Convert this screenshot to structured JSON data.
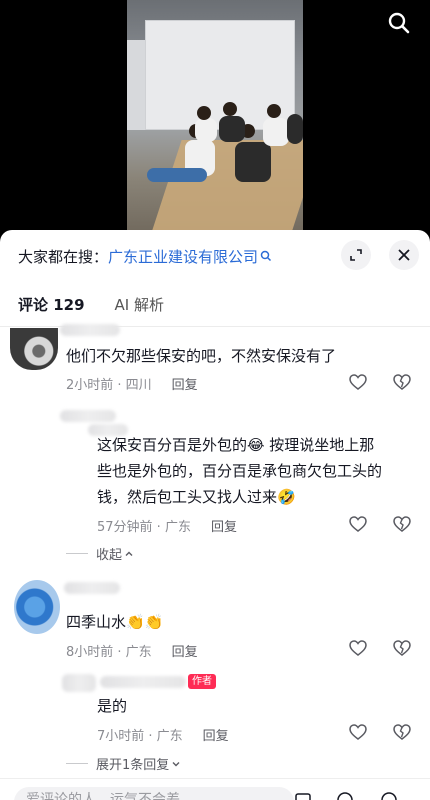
{
  "search_suggest": {
    "prefix": "大家都在搜：",
    "query": "广东正业建设有限公司"
  },
  "tabs": [
    {
      "label": "评论 129"
    },
    {
      "label": "AI 解析"
    }
  ],
  "comments": [
    {
      "text": "他们不欠那些保安的吧，不然安保没有了",
      "meta": "2小时前 · 四川",
      "reply": "回复"
    },
    {
      "text_line1": "这保安百分百是外包的😂 按理说坐地上那",
      "text_line2": "些也是外包的，百分百是承包商欠包工头的",
      "text_line3": "钱，然后包工头又找人过来🤣",
      "meta": "57分钟前 · 广东",
      "reply": "回复",
      "collapse": "收起"
    },
    {
      "text": "四季山水👏👏",
      "meta": "8小时前 · 广东",
      "reply": "回复"
    },
    {
      "badge": "作者",
      "text": "是的",
      "meta": "7小时前 · 广东",
      "reply": "回复",
      "expand": "展开1条回复"
    }
  ],
  "input": {
    "placeholder": "爱评论的人，运气不会差"
  },
  "colors": {
    "link": "#2b6bd6",
    "badge": "#fe2c55"
  }
}
